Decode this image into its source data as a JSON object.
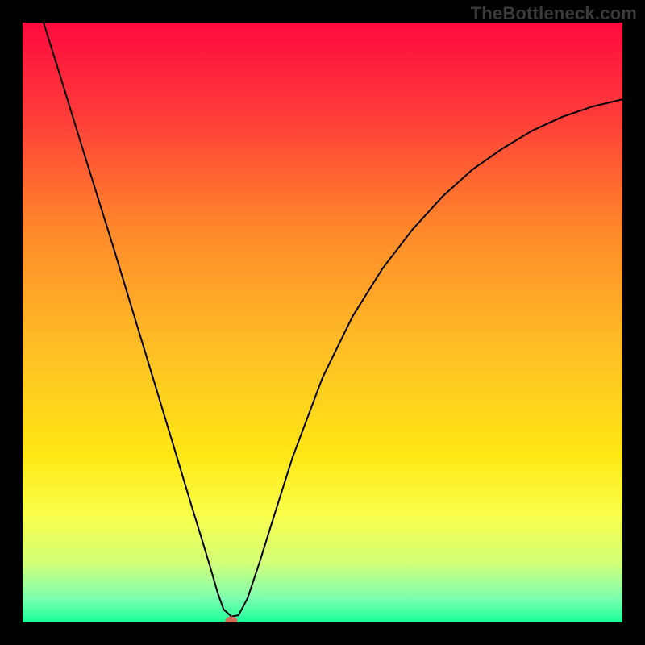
{
  "watermark": "TheBottleneck.com",
  "chart_data": {
    "type": "line",
    "title": "",
    "xlabel": "",
    "ylabel": "",
    "xlim": [
      0,
      1
    ],
    "ylim": [
      0,
      1
    ],
    "x_ticks": [],
    "y_ticks": [],
    "legend": null,
    "grid": false,
    "background_gradient": {
      "direction": "vertical",
      "stops": [
        {
          "offset": 0.0,
          "color": "#ff0a3f"
        },
        {
          "offset": 0.15,
          "color": "#ff3a3a"
        },
        {
          "offset": 0.35,
          "color": "#ff8a2a"
        },
        {
          "offset": 0.55,
          "color": "#ffc025"
        },
        {
          "offset": 0.72,
          "color": "#ffe714"
        },
        {
          "offset": 0.82,
          "color": "#faff4a"
        },
        {
          "offset": 0.9,
          "color": "#d3ff78"
        },
        {
          "offset": 0.96,
          "color": "#7cffb0"
        },
        {
          "offset": 1.0,
          "color": "#18ff9a"
        }
      ]
    },
    "series": [
      {
        "name": "bottleneck-curve",
        "color": "#000000",
        "stroke_width": 2,
        "x": [
          0.035,
          0.06,
          0.1,
          0.15,
          0.2,
          0.25,
          0.28,
          0.3,
          0.315,
          0.325,
          0.335,
          0.348,
          0.36,
          0.375,
          0.395,
          0.42,
          0.45,
          0.5,
          0.55,
          0.6,
          0.65,
          0.7,
          0.75,
          0.8,
          0.85,
          0.9,
          0.95,
          1.0
        ],
        "y": [
          1.0,
          0.92,
          0.79,
          0.63,
          0.465,
          0.3,
          0.2,
          0.135,
          0.085,
          0.05,
          0.022,
          0.01,
          0.012,
          0.04,
          0.1,
          0.18,
          0.275,
          0.408,
          0.51,
          0.59,
          0.655,
          0.71,
          0.755,
          0.79,
          0.82,
          0.843,
          0.86,
          0.872
        ]
      }
    ],
    "marker": {
      "name": "optimal-point",
      "x": 0.348,
      "y": 0.002,
      "color": "#d46a5a",
      "rx": 0.01,
      "ry": 0.008
    }
  }
}
